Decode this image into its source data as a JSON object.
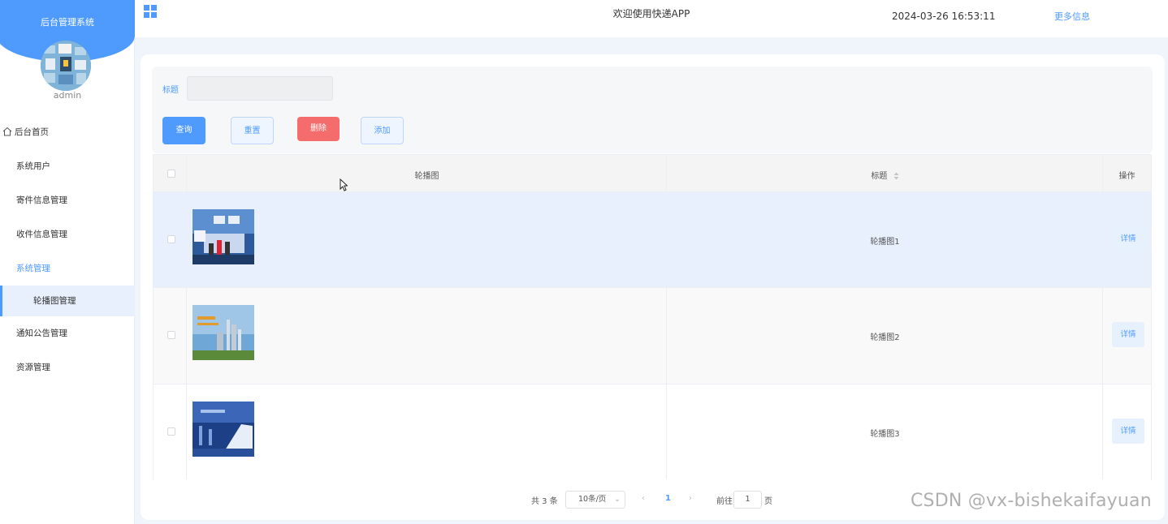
{
  "sidebar": {
    "title": "后台管理系统",
    "username": "admin",
    "items": [
      {
        "label": "后台首页"
      },
      {
        "label": "系统用户"
      },
      {
        "label": "寄件信息管理"
      },
      {
        "label": "收件信息管理"
      },
      {
        "label": "系统管理"
      },
      {
        "label": "轮播图管理"
      },
      {
        "label": "通知公告管理"
      },
      {
        "label": "资源管理"
      }
    ]
  },
  "header": {
    "welcome": "欢迎使用快递APP",
    "datetime": "2024-03-26 16:53:11",
    "more": "更多信息"
  },
  "search": {
    "title_label": "标题",
    "title_value": "",
    "query_label": "查询",
    "reset_label": "重置",
    "delete_label": "删除",
    "add_label": "添加"
  },
  "table": {
    "columns": [
      "轮播图",
      "标题",
      "操作"
    ],
    "rows": [
      {
        "title": "轮播图1",
        "action": "详情"
      },
      {
        "title": "轮播图2",
        "action": "详情"
      },
      {
        "title": "轮播图3",
        "action": "详情"
      }
    ]
  },
  "pagination": {
    "total": "共 3 条",
    "page_size": "10条/页",
    "current_page": "1",
    "goto_label": "前往",
    "goto_value": "1",
    "page_unit": "页"
  },
  "watermark": "CSDN @vx-bishekaifayuan",
  "colors": {
    "accent": "#4e9bfd",
    "danger": "#f56c6c"
  }
}
